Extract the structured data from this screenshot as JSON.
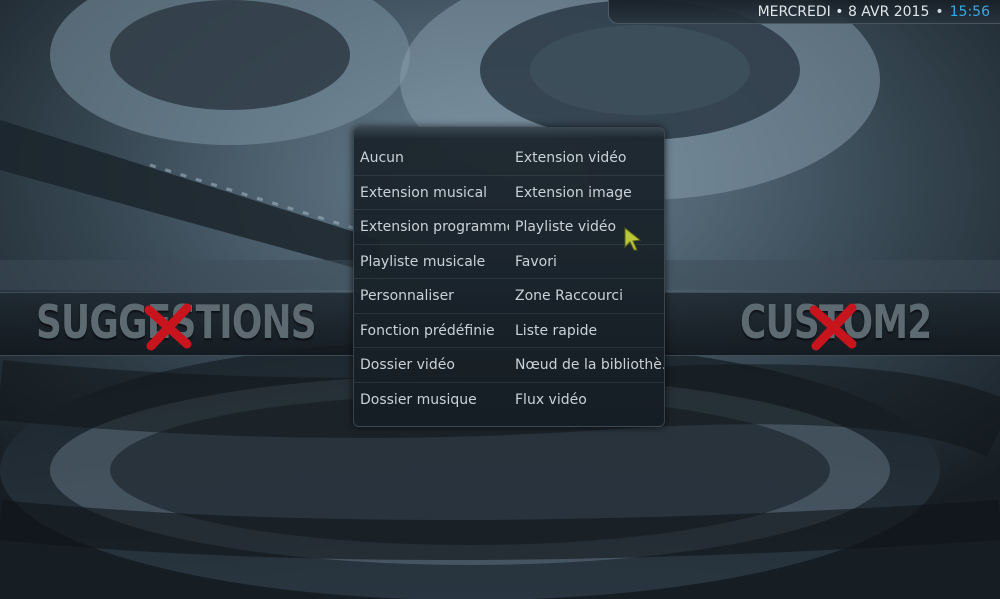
{
  "status": {
    "date": "MERCREDI • 8 AVR 2015",
    "separator": "•",
    "time": "15:56"
  },
  "home_band": {
    "left_label": "SUGGESTIONS",
    "right_label": "CUSTOM2"
  },
  "menu": {
    "left": [
      "Aucun",
      "Extension musical",
      "Extension programme",
      "Playliste musicale",
      "Personnaliser",
      "Fonction prédéfinie",
      "Dossier vidéo",
      "Dossier musique"
    ],
    "right": [
      "Extension vidéo",
      "Extension image",
      "Playliste vidéo",
      "Favori",
      "Zone Raccourci",
      "Liste rapide",
      "Nœud de la bibliothè...",
      "Flux vidéo"
    ]
  },
  "colors": {
    "accent": "#39a8e6",
    "x_mark": "#c8141c"
  }
}
